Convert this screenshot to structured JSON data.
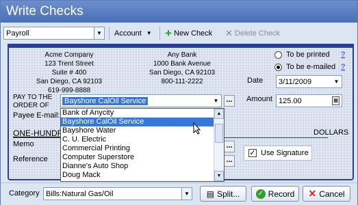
{
  "window": {
    "title": "Write Checks"
  },
  "toolbar": {
    "account_select": "Payroll",
    "account_menu": "Account",
    "new_check": "New Check",
    "delete_check": "Delete Check"
  },
  "company": {
    "name": "Acme Company",
    "address1": "123 Trent Street",
    "address2": "Suite # 400",
    "city": "San Diego, CA 92103",
    "phone": "619-999-8888"
  },
  "bank": {
    "name": "Any Bank",
    "address1": "1000 Bank Avenue",
    "city": "San Diego, CA 92103",
    "phone": "800-111-2222"
  },
  "delivery": {
    "printed": "To be printed",
    "emailed": "To be e-mailed",
    "help": "?",
    "selected": "emailed"
  },
  "date": {
    "label": "Date",
    "value": "3/11/2009"
  },
  "payee": {
    "label_line1": "PAY TO THE",
    "label_line2": "ORDER OF",
    "value": "Bayshore CalOil Service",
    "email_label": "Payee E-mail:"
  },
  "amount": {
    "label": "Amount",
    "value": "125.00"
  },
  "written_amount": {
    "value": "ONE-HUNDR",
    "dollars_label": "DOLLARS"
  },
  "memo": {
    "label": "Memo"
  },
  "reference": {
    "label": "Reference"
  },
  "signature": {
    "label": "Use Signature",
    "checked": true
  },
  "payee_list": [
    "Bank of Anycity",
    "Bayshore CalOil Service",
    "Bayshore Water",
    "C. U. Electric",
    "Commercial Printing",
    "Computer Superstore",
    "Dianne's Auto Shop",
    "Doug Mack"
  ],
  "payee_list_selected": 1,
  "footer": {
    "category_label": "Category",
    "category_value": "Bills:Natural Gas/Oil",
    "split": "Split...",
    "record": "Record",
    "cancel": "Cancel"
  },
  "colors": {
    "title_bar": "#4a6fb8",
    "check_border": "#2a3f8f",
    "selection": "#3876d9",
    "new_icon": "#22a322",
    "record_icon": "#2e9e2e",
    "cancel_icon": "#d22"
  }
}
